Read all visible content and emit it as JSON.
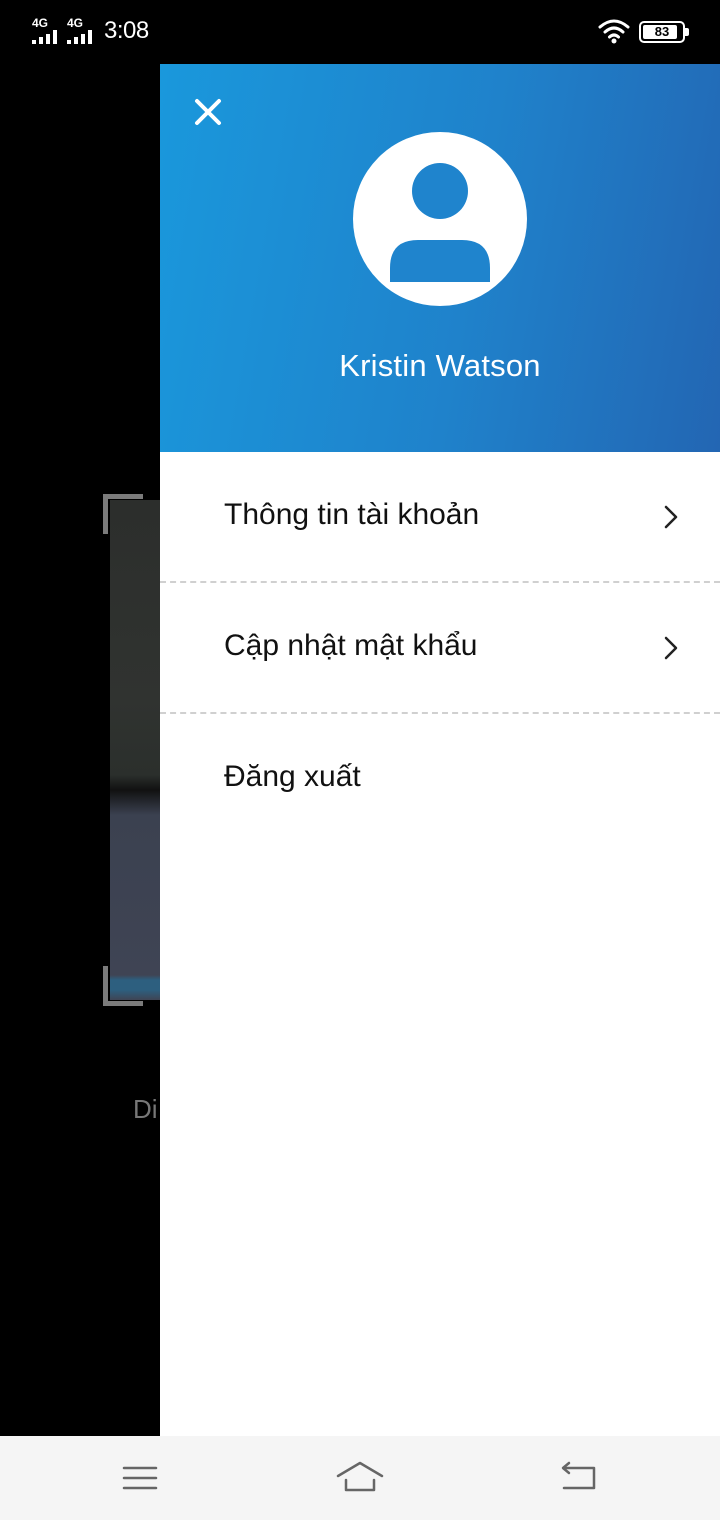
{
  "status_bar": {
    "network_1": "4G",
    "network_2": "4G",
    "time": "3:08",
    "battery_level": "83",
    "icons": [
      "signal-icon",
      "wifi-icon",
      "battery-icon"
    ]
  },
  "background": {
    "caption_fragment": "Di"
  },
  "drawer": {
    "header_color_start": "#1a98dc",
    "header_color_end": "#2366b3",
    "user_name": "Kristin Watson",
    "icons": [
      "close-icon",
      "user-avatar-icon"
    ],
    "menu": [
      {
        "label": "Thông tin tài khoản",
        "icon": "chevron-right-icon"
      },
      {
        "label": "Cập nhật mật khẩu",
        "icon": "chevron-right-icon"
      },
      {
        "label": "Đăng xuất"
      }
    ]
  },
  "nav_bar": {
    "icons": [
      "menu-icon",
      "home-icon",
      "back-icon"
    ]
  }
}
